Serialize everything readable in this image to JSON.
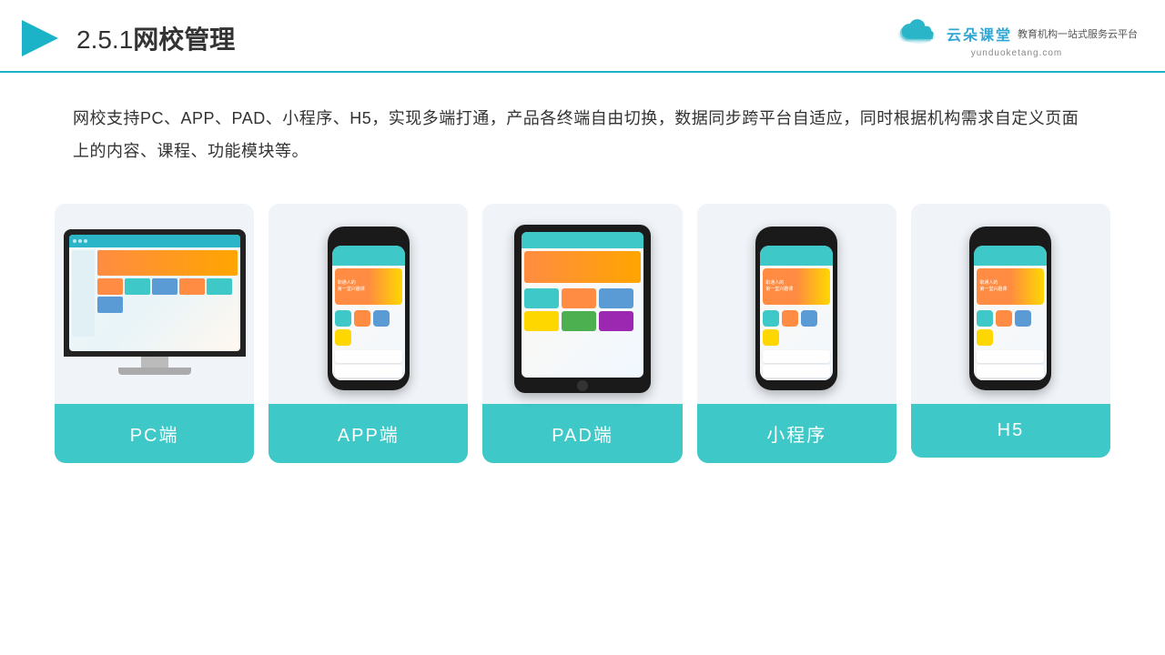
{
  "header": {
    "section": "2.5.1",
    "title": "网校管理",
    "logo": {
      "name_cn": "云朵课堂",
      "name_en": "yunduoketang.com",
      "tagline": "教育机构一站式服务云平台"
    }
  },
  "description": "网校支持PC、APP、PAD、小程序、H5，实现多端打通，产品各终端自由切换，数据同步跨平台自适应，同时根据机构需求自定义页面上的内容、课程、功能模块等。",
  "cards": [
    {
      "id": "pc",
      "label": "PC端"
    },
    {
      "id": "app",
      "label": "APP端"
    },
    {
      "id": "pad",
      "label": "PAD端"
    },
    {
      "id": "miniprogram",
      "label": "小程序"
    },
    {
      "id": "h5",
      "label": "H5"
    }
  ],
  "colors": {
    "accent": "#3ec8c8",
    "header_border": "#1ab3c8",
    "card_bg": "#f0f4f8",
    "text_dark": "#333333"
  }
}
